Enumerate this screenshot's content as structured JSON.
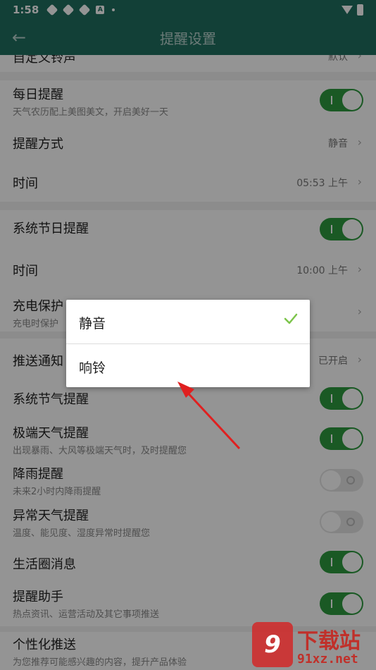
{
  "status_bar": {
    "time": "1:58",
    "a_icon_text": "A"
  },
  "app_bar": {
    "back_label": "←",
    "title": "提醒设置"
  },
  "settings": {
    "partial_top": {
      "title": "自定义铃声",
      "value": "默认"
    },
    "daily": {
      "title": "每日提醒",
      "subtitle": "天气农历配上美图美文，开启美好一天",
      "toggle": "on"
    },
    "remind_mode": {
      "title": "提醒方式",
      "value": "静音"
    },
    "daily_time": {
      "title": "时间",
      "value": "05:53 上午"
    },
    "holiday": {
      "title": "系统节日提醒",
      "toggle": "on"
    },
    "holiday_time": {
      "title": "时间",
      "value": "10:00 上午"
    },
    "charge": {
      "title": "充电保护",
      "subtitle": "充电时保护"
    },
    "push": {
      "title": "推送通知",
      "value": "已开启"
    },
    "solar_term": {
      "title": "系统节气提醒",
      "toggle": "on"
    },
    "extreme": {
      "title": "极端天气提醒",
      "subtitle": "出现暴雨、大风等极端天气时，及时提醒您",
      "toggle": "on"
    },
    "rain": {
      "title": "降雨提醒",
      "subtitle": "未来2小时内降雨提醒",
      "toggle": "off"
    },
    "abnormal": {
      "title": "异常天气提醒",
      "subtitle": "温度、能见度、湿度异常时提醒您",
      "toggle": "off"
    },
    "life": {
      "title": "生活圈消息",
      "toggle": "on"
    },
    "assistant": {
      "title": "提醒助手",
      "subtitle": "热点资讯、运营活动及其它事项推送",
      "toggle": "on"
    },
    "personal": {
      "title": "个性化推送",
      "subtitle": "为您推荐可能感兴趣的内容，提升产品体验"
    }
  },
  "dialog": {
    "options": [
      {
        "label": "静音",
        "selected": true
      },
      {
        "label": "响铃",
        "selected": false
      }
    ]
  },
  "watermark": {
    "logo": "9",
    "top": "下载站",
    "bottom": "91xz.net"
  },
  "colors": {
    "header": "#1f6e60",
    "toggle_on": "#2e9a3e",
    "arrow": "#e02020",
    "check": "#7cc44a"
  }
}
